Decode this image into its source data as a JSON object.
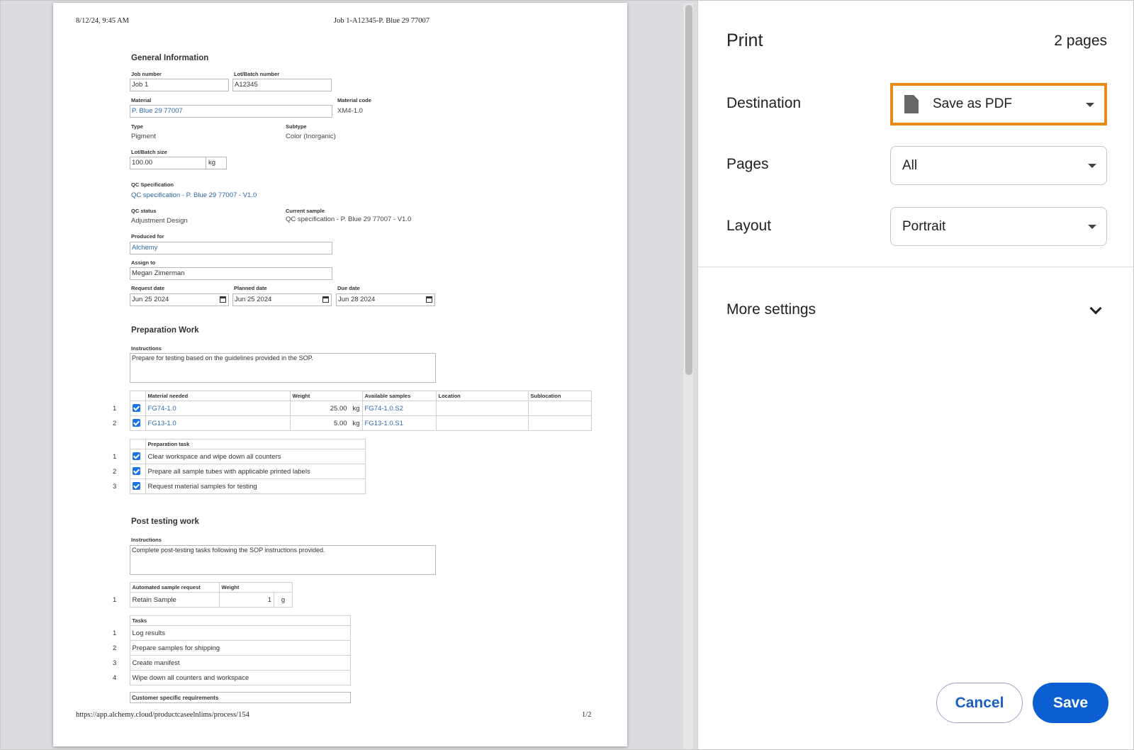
{
  "doc": {
    "header_left": "8/12/24, 9:45 AM",
    "header_center": "Job 1-A12345-P. Blue 29 77007",
    "footer_url": "https://app.alchemy.cloud/productcaseelnlims/process/154",
    "footer_page": "1/2",
    "general": {
      "title": "General Information",
      "job_number_label": "Job number",
      "job_number": "Job 1",
      "lot_label": "Lot/Batch number",
      "lot": "A12345",
      "material_label": "Material",
      "material": "P. Blue 29 77007",
      "material_code_label": "Material code",
      "material_code": "XM4-1.0",
      "type_label": "Type",
      "type": "Pigment",
      "subtype_label": "Subtype",
      "subtype": "Color (Inorganic)",
      "lot_size_label": "Lot/Batch size",
      "lot_size": "100.00",
      "lot_size_unit": "kg",
      "qc_spec_label": "QC Specification",
      "qc_spec": "QC specification - P. Blue 29 77007 - V1.0",
      "qc_status_label": "QC status",
      "qc_status": "Adjustment Design",
      "current_sample_label": "Current sample",
      "current_sample": "QC specification - P. Blue 29 77007 - V1.0",
      "produced_for_label": "Produced for",
      "produced_for": "Alchemy",
      "assign_to_label": "Assign to",
      "assign_to": "Megan Zimerman",
      "request_date_label": "Request date",
      "request_date": "Jun 25 2024",
      "planned_date_label": "Planned date",
      "planned_date": "Jun 25 2024",
      "due_date_label": "Due date",
      "due_date": "Jun 28 2024"
    },
    "prep": {
      "title": "Preparation Work",
      "instructions_label": "Instructions",
      "instructions": "Prepare for testing based on the guidelines provided in the SOP.",
      "materials_headers": [
        "Material needed",
        "Weight",
        "Available samples",
        "Location",
        "Sublocation"
      ],
      "materials": [
        {
          "n": "1",
          "material": "FG74-1.0",
          "weight": "25.00",
          "unit": "kg",
          "sample": "FG74-1.0.S2"
        },
        {
          "n": "2",
          "material": "FG13-1.0",
          "weight": "5.00",
          "unit": "kg",
          "sample": "FG13-1.0.S1"
        }
      ],
      "task_header": "Preparation task",
      "tasks": [
        {
          "n": "1",
          "text": "Clear workspace and wipe down all counters"
        },
        {
          "n": "2",
          "text": "Prepare all sample tubes with applicable printed labels"
        },
        {
          "n": "3",
          "text": "Request material samples for testing"
        }
      ]
    },
    "post": {
      "title": "Post testing work",
      "instructions_label": "Instructions",
      "instructions": "Complete post-testing tasks following the SOP instructions provided.",
      "auto_header": "Automated sample request",
      "weight_header": "Weight",
      "auto_row": {
        "n": "1",
        "name": "Retain Sample",
        "weight": "1",
        "unit": "g"
      },
      "tasks_header": "Tasks",
      "tasks": [
        {
          "n": "1",
          "text": "Log results"
        },
        {
          "n": "2",
          "text": "Prepare samples for shipping"
        },
        {
          "n": "3",
          "text": "Create manifest"
        },
        {
          "n": "4",
          "text": "Wipe down all counters and workspace"
        }
      ],
      "customer_req": "Customer specific requirements"
    }
  },
  "panel": {
    "title": "Print",
    "page_count": "2 pages",
    "destination_label": "Destination",
    "destination_value": "Save as PDF",
    "destination_icon": "document-icon",
    "pages_label": "Pages",
    "pages_value": "All",
    "layout_label": "Layout",
    "layout_value": "Portrait",
    "more_settings": "More settings",
    "cancel": "Cancel",
    "save": "Save",
    "highlight_color": "#ea8a16",
    "accent_color": "#0b5fd3"
  }
}
